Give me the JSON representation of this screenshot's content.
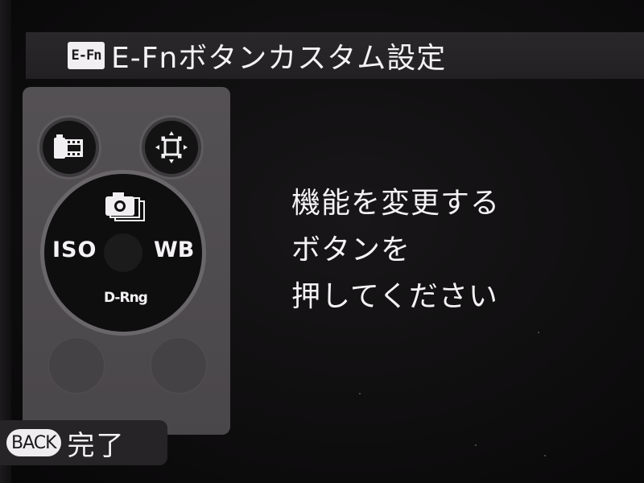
{
  "header": {
    "badge_label": "E-Fn",
    "title": "E-Fnボタンカスタム設定"
  },
  "camera_panel": {
    "buttons": [
      {
        "id": "film",
        "icon": "film-simulation-icon"
      },
      {
        "id": "af",
        "icon": "af-frame-icon"
      }
    ],
    "dial": {
      "top_icon": "drive-mode-icon",
      "left_label": "ISO",
      "right_label": "WB",
      "bottom_label": "D-Rng"
    },
    "blank_buttons": 2
  },
  "message": {
    "line1": "機能を変更する",
    "line2": "ボタンを",
    "line3": "押してください"
  },
  "footer": {
    "back_label": "BACK",
    "action_label": "完了"
  },
  "colors": {
    "background": "#0c0b0c",
    "title_bar": "#262426",
    "panel": "#4f4c4f",
    "text": "#f4f2f4"
  }
}
